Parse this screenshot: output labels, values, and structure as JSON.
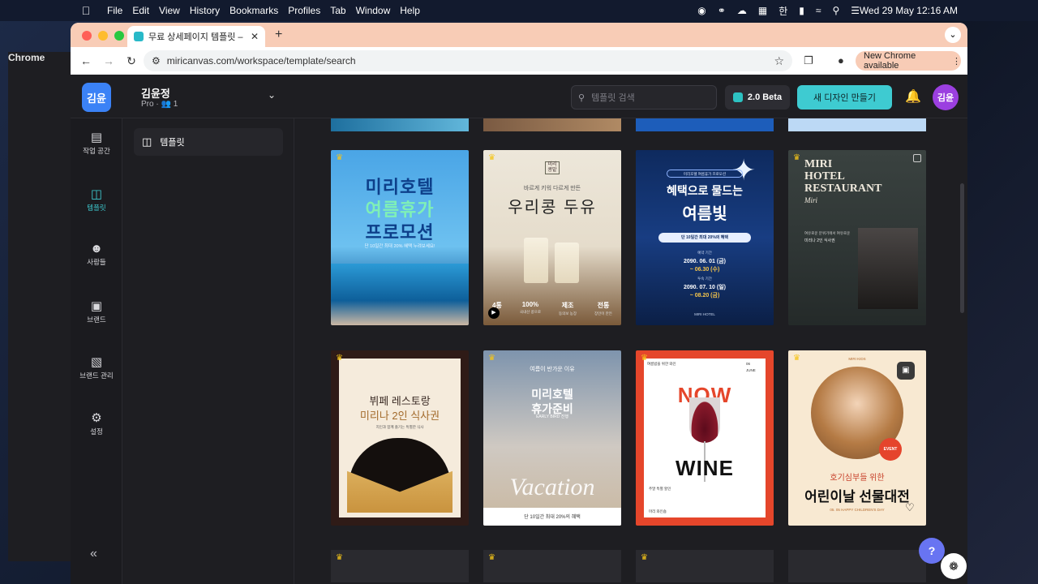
{
  "menubar": {
    "app": "Chrome",
    "items": [
      "File",
      "Edit",
      "View",
      "History",
      "Bookmarks",
      "Profiles",
      "Tab",
      "Window",
      "Help"
    ],
    "clock": "Wed 29 May  12:16 AM",
    "korean_indicator": "한"
  },
  "browser": {
    "tab_title": "무료 상세페이지 템플릿 – 미리캔버스",
    "url": "miricanvas.com/workspace/template/search",
    "new_chrome": "New Chrome available"
  },
  "app": {
    "workspace": {
      "avatar": "김윤",
      "name": "김윤정",
      "plan": "Pro",
      "members": "1"
    },
    "search_placeholder": "템플릿 검색",
    "beta_label": "2.0 Beta",
    "create_label": "새 디자인 만들기",
    "user_avatar": "김윤",
    "sidebar": [
      {
        "label": "작업 공간",
        "icon": "archive-icon",
        "active": false
      },
      {
        "label": "템플릿",
        "icon": "template-icon",
        "active": true
      },
      {
        "label": "사람들",
        "icon": "people-icon",
        "active": false
      },
      {
        "label": "브랜드",
        "icon": "brand-icon",
        "active": false
      },
      {
        "label": "브랜드 관리",
        "icon": "brand-manage-icon",
        "active": false
      },
      {
        "label": "설정",
        "icon": "gear-icon",
        "active": false
      }
    ],
    "panel_item": "템플릿",
    "cards": [
      {
        "lines": [
          "미리호텔",
          "여름휴가",
          "프로모션",
          "단 10일간 최대 20% 혜택 누려보세요!"
        ],
        "premium": true
      },
      {
        "badge": "미리\n콩밭",
        "lines": [
          "바르게 키워 다르게 만든",
          "우리콩 두유"
        ],
        "stats": [
          {
            "v": "4통",
            "s": ""
          },
          {
            "v": "100%",
            "s": "국내산 콩으로"
          },
          {
            "v": "제조",
            "s": "동의보 농장"
          },
          {
            "v": "전통",
            "s": "장인이 만든"
          }
        ],
        "premium": true
      },
      {
        "lines": [
          "미리호텔 여름휴가 프로모션",
          "혜택으로 물드는",
          "여름빛",
          "단 10일간 최대 20%의 혜택",
          "예약 기간",
          "2090. 06. 01 (금)",
          "~ 06.30 (수)",
          "투숙 기간",
          "2090. 07. 10 (일)",
          "~ 08.20 (금)",
          "MIRI HOTEL"
        ],
        "premium": false
      },
      {
        "lines": [
          "MIRI",
          "HOTEL",
          "RESTAURANT",
          "Miri",
          "여유로운 분위기에서 여유로운",
          "미리나 2인 식사권"
        ],
        "premium": true
      },
      {
        "lines": [
          "뷔페 레스토랑",
          "미리나 2인 식사권",
          "지인과 함께 즐기는 특별한 식사"
        ],
        "premium": true
      },
      {
        "lines": [
          "여름이 반가운 이유",
          "미리호텔",
          "휴가준비",
          "EARLY BIRD 진행",
          "Vacation",
          "단 10일간 최대 20%의 혜택"
        ],
        "premium": true
      },
      {
        "lines": [
          "여름밤을 위한 와인",
          "06",
          "JUNE",
          "NOW",
          "WINE",
          "주말 특별 할인",
          "마리 와인숍"
        ],
        "premium": true
      },
      {
        "lines": [
          "MIRI KIDS",
          "EVENT",
          "호기심부들 위한",
          "어린이날 선물대전",
          "05. 05 HAPPY CHILDREN'S DAY"
        ],
        "premium": true
      }
    ]
  }
}
